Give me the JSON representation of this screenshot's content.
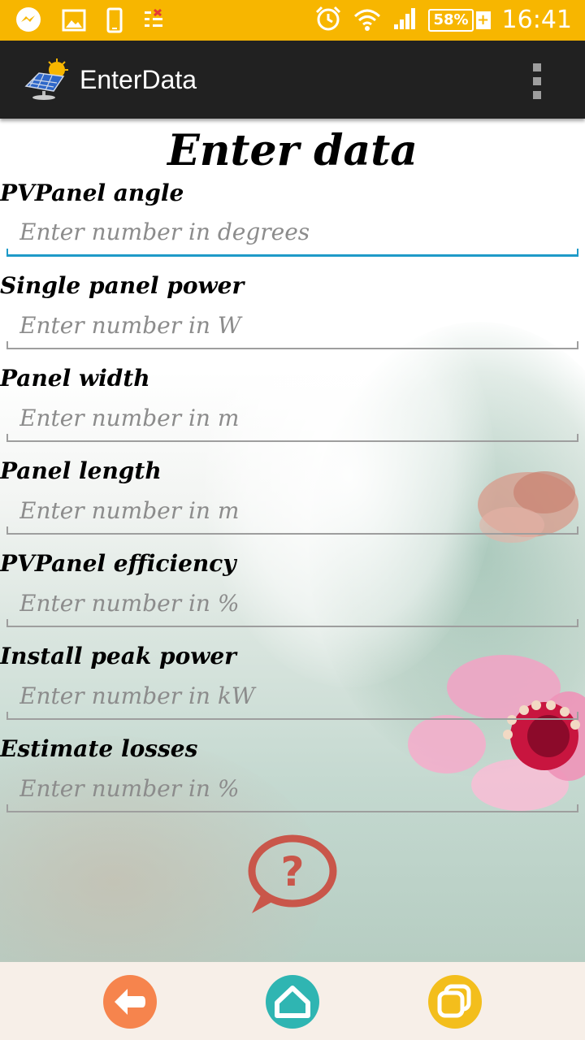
{
  "status_bar": {
    "time": "16:41",
    "battery_percent": "58%",
    "icons": [
      "messenger-icon",
      "gallery-icon",
      "phone-icon",
      "notes-icon",
      "alarm-icon",
      "wifi-icon",
      "signal-icon",
      "battery-icon"
    ]
  },
  "app_bar": {
    "title": "EnterData",
    "logo": "solar-panel-icon",
    "menu": "overflow-menu-icon"
  },
  "form": {
    "heading": "Enter data",
    "fields": [
      {
        "label": "PVPanel angle",
        "placeholder": "Enter number in degrees",
        "value": ""
      },
      {
        "label": "Single panel power",
        "placeholder": "Enter number in W",
        "value": ""
      },
      {
        "label": "Panel width",
        "placeholder": "Enter number in m",
        "value": ""
      },
      {
        "label": "Panel length",
        "placeholder": "Enter number in m",
        "value": ""
      },
      {
        "label": "PVPanel efficiency",
        "placeholder": "Enter number in %",
        "value": ""
      },
      {
        "label": "Install peak power",
        "placeholder": "Enter number in kW",
        "value": ""
      },
      {
        "label": "Estimate losses",
        "placeholder": "Enter number in %",
        "value": ""
      }
    ],
    "help_icon": "help-bubble-icon",
    "help_glyph": "?"
  },
  "bottom_nav": {
    "buttons": [
      "back-icon",
      "home-icon",
      "recent-apps-icon"
    ]
  },
  "colors": {
    "status_bar": "#f7b600",
    "app_bar": "#212121",
    "active_underline": "#1e9ac8",
    "help": "#c9564a",
    "back": "#f6844d",
    "home": "#2fb5b2",
    "recent": "#f3be1c",
    "bottom_bar": "#f7efe8"
  }
}
